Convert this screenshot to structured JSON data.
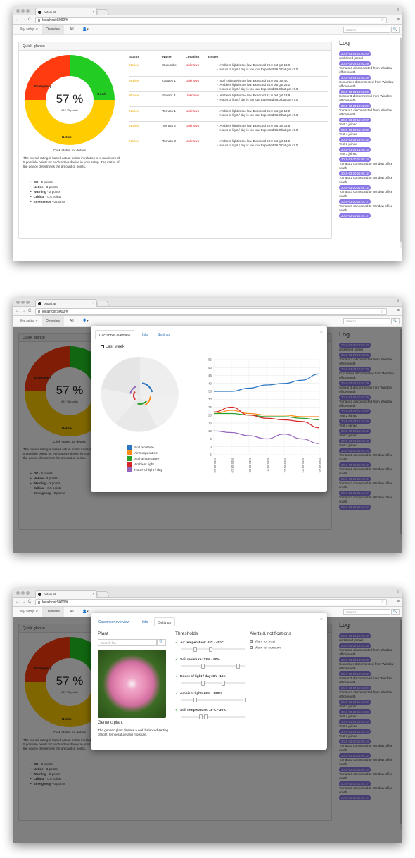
{
  "browser": {
    "tab_title": "botani.at",
    "url": "localhost:5000/#",
    "close": "×",
    "window_btn": "⇧",
    "menu": "≡",
    "star": "☆"
  },
  "nav": {
    "my_setup": "My setup ▾",
    "overview": "Overview",
    "all": "All",
    "user": "👤▾",
    "search_placeholder": "Search",
    "search_icon": "🔍"
  },
  "quick_glance": {
    "title": "Quick glance",
    "percent": "57 %",
    "points": "43 / 75 points",
    "segments": {
      "emergency": "Emergency",
      "good": "Good",
      "notice": "Notice"
    },
    "donut": {
      "emergency": 0.25,
      "good": 0.25,
      "notice": 0.5,
      "colors": {
        "emergency": "#ff3b0f",
        "good": "#22cc22",
        "notice": "#ffcc00"
      }
    },
    "click_status": "Click status for details",
    "description": "The overall rating is based actual points in relation to a maximum of 5 possible points for each active device in your setup. The status of the device determines the amount of points.",
    "legend": [
      {
        "label": "OK",
        "value": " - 5 points"
      },
      {
        "label": "Notice",
        "value": " - 3 points"
      },
      {
        "label": "Warning",
        "value": " - 2 points"
      },
      {
        "label": "Critical",
        "value": " - 0.5 points"
      },
      {
        "label": "Emergency",
        "value": " - 0 points"
      }
    ]
  },
  "table": {
    "headers": [
      "Status",
      "Name",
      "Location",
      "Issues"
    ],
    "rows": [
      {
        "status": "Notice",
        "name": "Cucumber",
        "location": "Unknown",
        "issues": [
          "Ambient light is too low. Expected 20.0 but got 13.9",
          "Hours of light / day is too low. Expected 56.0 but got 47.0"
        ]
      },
      {
        "status": "Notice",
        "name": "Grapes 1",
        "location": "Unknown",
        "issues": [
          "Soil moisture is too low. Expected 33.0 but got 4.0",
          "Ambient light is too low. Expected 35.0 but got 26.2",
          "Hours of light / day is too low. Expected 56.0 but got 47.0"
        ]
      },
      {
        "status": "Notice",
        "name": "Sensor 3",
        "location": "Unknown",
        "issues": [
          "Ambient light is too low. Expected 21.0 but got 13.9",
          "Hours of light / day is too low. Expected 56.0 but got 47.0"
        ]
      },
      {
        "status": "Notice",
        "name": "Tomato 1",
        "location": "Unknown",
        "issues": [
          "Ambient light is too low. Expected 35.0 but got 13.9",
          "Hours of light / day is too low. Expected 56.0 but got 47.0"
        ]
      },
      {
        "status": "Notice",
        "name": "Tomato 2",
        "location": "Unknown",
        "issues": [
          "Ambient light is too low. Expected 20.0 but got 13.9",
          "Hours of light / day is too low. Expected 56.0 but got 47.0"
        ]
      },
      {
        "status": "Notice",
        "name": "Tomato 3",
        "location": "Unknown",
        "issues": [
          "Ambient light is too low. Expected 20.0 but got 13.9",
          "Hours of light / day is too low. Expected 56.0 but got 47.0"
        ]
      }
    ]
  },
  "log": {
    "title": "Log",
    "entries": [
      {
        "time": "2015-03-25 10:02:40",
        "msg": "undefined joined"
      },
      {
        "time": "2015-03-24 10:02:29",
        "msg": "Tomato 3 disconnected from Window office south"
      },
      {
        "time": "2015-03-24 10:02:29",
        "msg": "Cucumber disconnected from Window office south"
      },
      {
        "time": "2015-03-24 10:02:29",
        "msg": "Sensor 3 disconnected from Window office south"
      },
      {
        "time": "2015-03-24 10:02:29",
        "msg": "Tomato 2 disconnected from Window office south"
      },
      {
        "time": "2015-03-22 15:46:07",
        "msg": "Test 2 joined"
      },
      {
        "time": "2015-03-22 15:46:29",
        "msg": "Test 4 joined"
      },
      {
        "time": "2015-03-22 15:03:42",
        "msg": "Test 3 joined"
      },
      {
        "time": "2015-03-22 14:58:13",
        "msg": "Test 1 joined"
      },
      {
        "time": "2015-03-20 21:00:14",
        "msg": "Tomato 2 connected to Window office south"
      },
      {
        "time": "2015-03-20 21:00:12",
        "msg": "Tomato 2 connected to Window office south"
      },
      {
        "time": "2015-03-20 21:00:12",
        "msg": "Tomato 3 connected to Window office south"
      },
      {
        "time": "2015-03-20 21:44:17",
        "msg": "Tomato 3 connected to Window office south"
      },
      {
        "time": "2015-03-20 21:44:17",
        "msg": ""
      }
    ]
  },
  "modal1": {
    "tabs": [
      "Cucumber overview",
      "Info",
      "Settings"
    ],
    "close": "×",
    "section": "Last week",
    "chart_data": {
      "type": "line",
      "x": [
        "2015-03-18",
        "2015-03-19",
        "2015-03-20",
        "2015-03-21",
        "2015-03-22",
        "2015-03-23",
        "2015-03-24"
      ],
      "ylim": [
        -5,
        55
      ],
      "yticks": [
        55,
        50,
        45,
        40,
        35,
        30,
        25,
        20,
        15,
        10,
        5,
        0,
        -5
      ],
      "series": [
        {
          "name": "Soil moisture",
          "color": "#2a76c0",
          "values": [
            35,
            35,
            37,
            39,
            40,
            42,
            46
          ]
        },
        {
          "name": "Air temperature",
          "color": "#ff8c1a",
          "values": [
            21,
            23,
            21,
            20,
            20,
            19,
            19
          ]
        },
        {
          "name": "Soil temperature",
          "color": "#2ca02c",
          "values": [
            21,
            21,
            20,
            19,
            19,
            18,
            17
          ]
        },
        {
          "name": "Ambient light",
          "color": "#d62728",
          "values": [
            22,
            25,
            20,
            18,
            17,
            16,
            12
          ]
        },
        {
          "name": "Hours of light / day",
          "color": "#9467bd",
          "values": [
            10,
            9,
            7,
            5,
            8,
            5,
            2
          ]
        }
      ]
    }
  },
  "modal2": {
    "tabs": [
      "Cucumber overview",
      "Info",
      "Settings"
    ],
    "close": "×",
    "plant": {
      "heading": "Plant",
      "search_placeholder": "Search for...",
      "search_icon": "🔍",
      "name": "Generic plant",
      "description": "The generic plant desires a well balanced setting of light, temperature and moisture."
    },
    "thresholds": {
      "heading": "Thresholds",
      "items": [
        {
          "label": "Air temperature: 0°C - 40°C",
          "from": 0.2,
          "to": 0.45
        },
        {
          "label": "Soil moisture: 33% - 90%",
          "from": 0.33,
          "to": 0.9
        },
        {
          "label": "Hours of light / day: 8h - 16h",
          "from": 0.33,
          "to": 0.66
        },
        {
          "label": "Ambient light: 20% - 100%",
          "from": 0.2,
          "to": 1.0
        },
        {
          "label": "Soil temperature: 18°C - 30°C",
          "from": 0.3,
          "to": 0.38
        }
      ]
    },
    "alerts": {
      "heading": "Alerts & notifications",
      "items": [
        "Warn for frost",
        "Warn for sunburn"
      ]
    },
    "check": "✓"
  }
}
